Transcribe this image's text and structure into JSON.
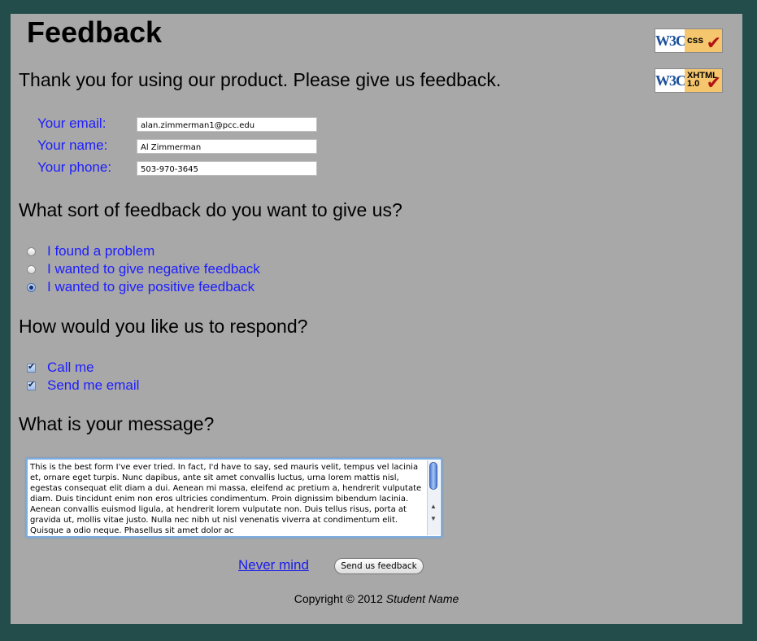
{
  "page": {
    "title": "Feedback",
    "intro": "Thank you for using our product. Please give us feedback."
  },
  "badges": [
    {
      "logo": "W3C",
      "label": "css"
    },
    {
      "logo": "W3C",
      "label": "XHTML",
      "sub": "1.0"
    }
  ],
  "contact": {
    "email_label": "Your email:",
    "email_value": "alan.zimmerman1@pcc.edu",
    "name_label": "Your name:",
    "name_value": "Al Zimmerman",
    "phone_label": "Your phone:",
    "phone_value": "503-970-3645"
  },
  "feedback_type": {
    "question": "What sort of feedback do you want to give us?",
    "options": [
      {
        "label": "I found a problem",
        "selected": false
      },
      {
        "label": "I wanted to give negative feedback",
        "selected": false
      },
      {
        "label": "I wanted to give positive feedback",
        "selected": true
      }
    ]
  },
  "respond": {
    "question": "How would you like us to respond?",
    "options": [
      {
        "label": "Call me",
        "checked": true
      },
      {
        "label": "Send me email",
        "checked": true
      }
    ]
  },
  "message": {
    "question": "What is your message?",
    "text": "This is the best form I've ever tried. In fact, I'd have to say, sed mauris velit, tempus vel lacinia et, ornare eget turpis. Nunc dapibus, ante sit amet convallis luctus, urna lorem mattis nisl, egestas consequat elit diam a dui. Aenean mi massa, eleifend ac pretium a, hendrerit vulputate diam. Duis tincidunt enim non eros ultricies condimentum. Proin dignissim bibendum lacinia. Aenean convallis euismod ligula, at hendrerit lorem vulputate non. Duis tellus risus, porta at gravida ut, mollis vitae justo. Nulla nec nibh ut nisl venenatis viverra at condimentum elit. Quisque a odio neque. Phasellus sit amet dolor ac"
  },
  "actions": {
    "cancel_link": "Never mind",
    "submit_label": "Send us feedback"
  },
  "footer": {
    "copyright": "Copyright © 2012",
    "author": "Student Name"
  },
  "colors": {
    "background": "#234d4b",
    "panel": "#a8a8a8",
    "label_blue": "#1d1dff"
  }
}
